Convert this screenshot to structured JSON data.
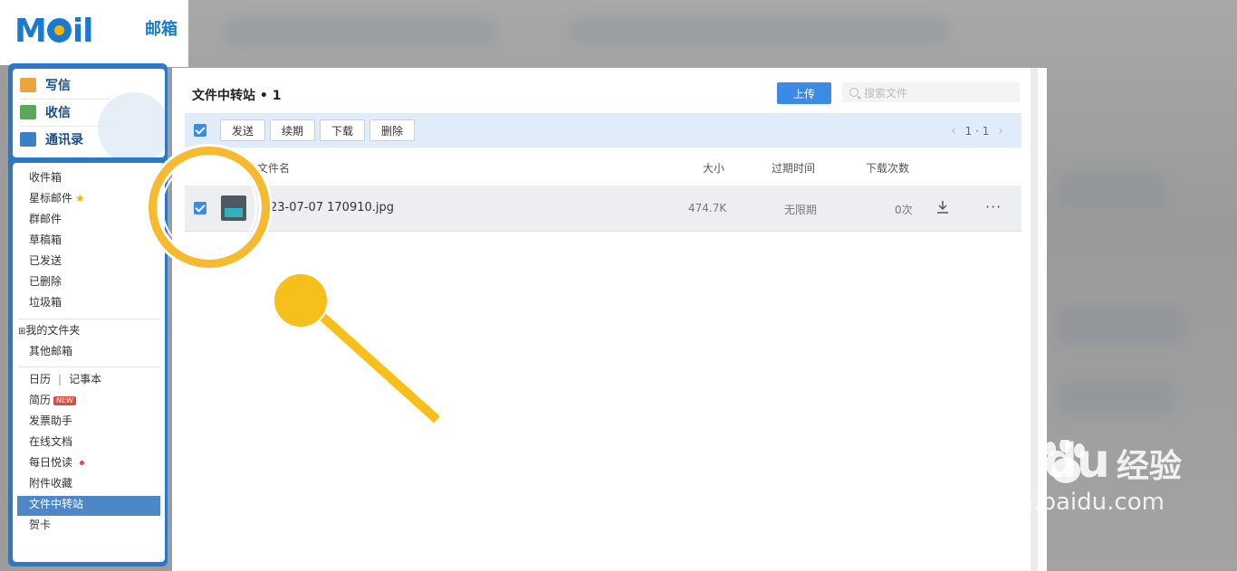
{
  "logo": {
    "text_m": "M",
    "text_il": "il",
    "mailbox": "邮箱"
  },
  "quick": {
    "compose": "写信",
    "inbox_check": "收信",
    "contacts": "通讯录"
  },
  "folders": {
    "inbox": "收件箱",
    "starred": "星标邮件",
    "group": "群邮件",
    "drafts": "草稿箱",
    "sent": "已发送",
    "deleted": "已删除",
    "spam": "垃圾箱",
    "my_folders": "我的文件夹",
    "other_mailboxes": "其他邮箱",
    "calendar": "日历",
    "notes": "记事本",
    "resume": "简历",
    "new_badge": "NEW",
    "invoice": "发票助手",
    "docs": "在线文档",
    "daily": "每日悦读",
    "attachments": "附件收藏",
    "transfer": "文件中转站",
    "cards": "贺卡"
  },
  "main": {
    "title": "文件中转站 • 1",
    "upload": "上传",
    "search_placeholder": "搜索文件"
  },
  "toolbar": {
    "send": "发送",
    "renew": "续期",
    "download": "下载",
    "delete": "删除",
    "page": "1 · 1"
  },
  "table": {
    "headers": {
      "name": "文件名",
      "size": "大小",
      "expire": "过期时间",
      "downloads": "下载次数"
    },
    "rows": [
      {
        "name": "23-07-07 170910.jpg",
        "size": "474.7K",
        "expire": "无限期",
        "downloads": "0次"
      }
    ]
  },
  "watermark": {
    "brand": "Bai du",
    "cn": "经验",
    "url": "jingyan.baidu.com"
  },
  "colors": {
    "accent": "#3b8ae6",
    "highlight": "#f7ba2e",
    "sidebar": "#2b78c9"
  }
}
